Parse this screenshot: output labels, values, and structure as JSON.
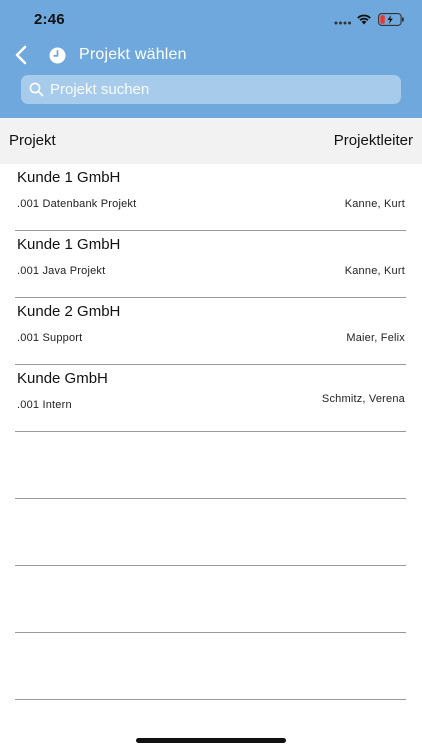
{
  "status_bar": {
    "time": "2:46"
  },
  "nav": {
    "title": "Projekt wählen",
    "back_icon": "chevron-left-icon",
    "title_icon": "clock-icon"
  },
  "search": {
    "placeholder": "Projekt suchen",
    "value": ""
  },
  "table_header": {
    "project": "Projekt",
    "leader": "Projektleiter"
  },
  "rows": [
    {
      "customer": "Kunde 1 GmbH",
      "project": ".001 Datenbank Projekt",
      "leader": "Kanne, Kurt"
    },
    {
      "customer": "Kunde 1 GmbH",
      "project": ".001 Java Projekt",
      "leader": "Kanne, Kurt"
    },
    {
      "customer": "Kunde 2 GmbH",
      "project": ".001 Support",
      "leader": "Maier, Felix"
    },
    {
      "customer": "Kunde GmbH",
      "project": ".001 Intern",
      "leader": "Schmitz, Verena"
    }
  ],
  "colors": {
    "header_bg": "#6fa8dc",
    "search_bg": "#a6cbeb",
    "column_header_bg": "#f2f2f2",
    "battery_low": "#e53935"
  }
}
